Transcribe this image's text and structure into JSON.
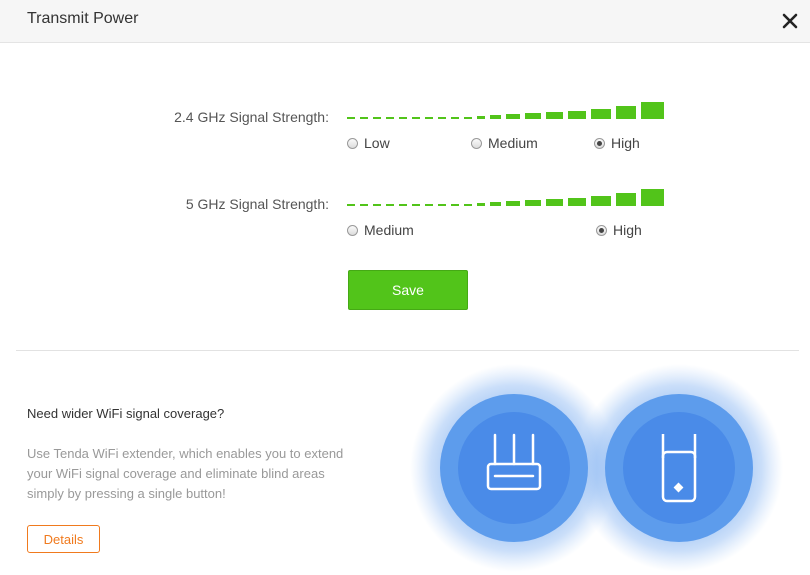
{
  "header": {
    "title": "Transmit Power",
    "close_icon": "close-icon"
  },
  "band_24": {
    "label": "2.4 GHz Signal Strength:",
    "options": [
      "Low",
      "Medium",
      "High"
    ],
    "selected": "High",
    "level": 1.0
  },
  "band_5": {
    "label": "5 GHz Signal Strength:",
    "options": [
      "Medium",
      "High"
    ],
    "selected": "High",
    "level": 1.0
  },
  "save_label": "Save",
  "promo": {
    "heading": "Need wider WiFi signal coverage?",
    "text": "Use Tenda WiFi extender, which enables you to extend your WiFi signal coverage and eliminate blind areas simply by pressing a single button!",
    "details_label": "Details",
    "icons": [
      "router-icon",
      "extender-icon"
    ]
  },
  "colors": {
    "accent_green": "#52c41a",
    "accent_orange": "#f07a1e",
    "glow_blue": "#4a8fea"
  }
}
